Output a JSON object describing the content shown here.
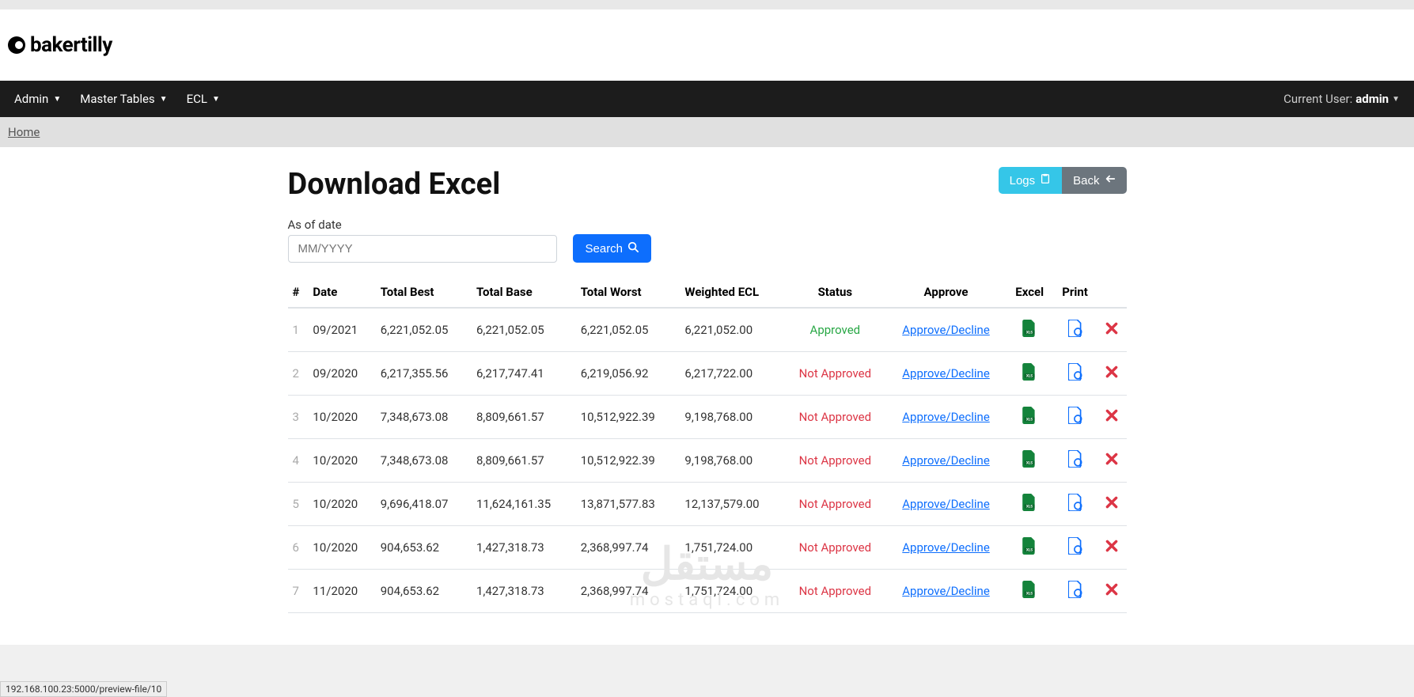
{
  "brand": {
    "name": "bakertilly"
  },
  "nav": {
    "items": [
      "Admin",
      "Master Tables",
      "ECL"
    ],
    "current_user_label": "Current User:",
    "current_user": "admin"
  },
  "breadcrumb": {
    "home": "Home"
  },
  "page": {
    "title": "Download Excel",
    "logs_btn": "Logs",
    "back_btn": "Back"
  },
  "search": {
    "label": "As of date",
    "placeholder": "MM/YYYY",
    "button": "Search"
  },
  "table": {
    "headers": {
      "idx": "#",
      "date": "Date",
      "total_best": "Total Best",
      "total_base": "Total Base",
      "total_worst": "Total Worst",
      "weighted_ecl": "Weighted ECL",
      "status": "Status",
      "approve": "Approve",
      "excel": "Excel",
      "print": "Print"
    },
    "approve_link": "Approve/Decline",
    "rows": [
      {
        "idx": "1",
        "date": "09/2021",
        "best": "6,221,052.05",
        "base": "6,221,052.05",
        "worst": "6,221,052.05",
        "wecl": "6,221,052.00",
        "status": "Approved",
        "status_class": "approved"
      },
      {
        "idx": "2",
        "date": "09/2020",
        "best": "6,217,355.56",
        "base": "6,217,747.41",
        "worst": "6,219,056.92",
        "wecl": "6,217,722.00",
        "status": "Not Approved",
        "status_class": "notapproved"
      },
      {
        "idx": "3",
        "date": "10/2020",
        "best": "7,348,673.08",
        "base": "8,809,661.57",
        "worst": "10,512,922.39",
        "wecl": "9,198,768.00",
        "status": "Not Approved",
        "status_class": "notapproved"
      },
      {
        "idx": "4",
        "date": "10/2020",
        "best": "7,348,673.08",
        "base": "8,809,661.57",
        "worst": "10,512,922.39",
        "wecl": "9,198,768.00",
        "status": "Not Approved",
        "status_class": "notapproved"
      },
      {
        "idx": "5",
        "date": "10/2020",
        "best": "9,696,418.07",
        "base": "11,624,161.35",
        "worst": "13,871,577.83",
        "wecl": "12,137,579.00",
        "status": "Not Approved",
        "status_class": "notapproved"
      },
      {
        "idx": "6",
        "date": "10/2020",
        "best": "904,653.62",
        "base": "1,427,318.73",
        "worst": "2,368,997.74",
        "wecl": "1,751,724.00",
        "status": "Not Approved",
        "status_class": "notapproved"
      },
      {
        "idx": "7",
        "date": "11/2020",
        "best": "904,653.62",
        "base": "1,427,318.73",
        "worst": "2,368,997.74",
        "wecl": "1,751,724.00",
        "status": "Not Approved",
        "status_class": "notapproved"
      }
    ]
  },
  "watermark": {
    "big": "مستقل",
    "small": "mostaql.com"
  },
  "status_bar": "192.168.100.23:5000/preview-file/10"
}
